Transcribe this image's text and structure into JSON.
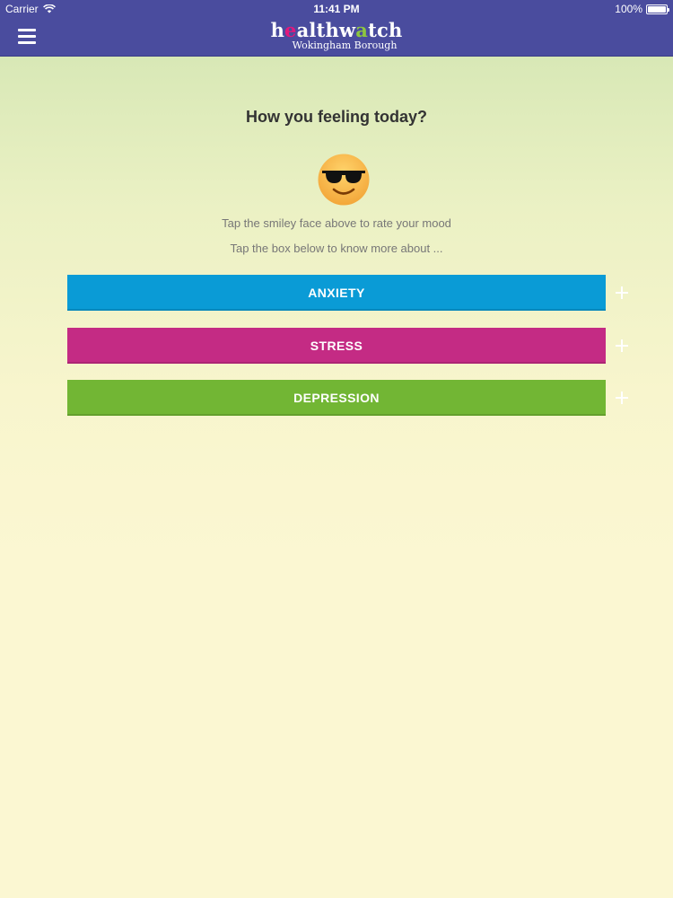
{
  "status_bar": {
    "carrier": "Carrier",
    "time": "11:41 PM",
    "battery": "100%",
    "battery_level": 1.0
  },
  "header": {
    "menu_icon": "hamburger-menu-icon",
    "logo_main_parts": [
      "h",
      "e",
      "althw",
      "a",
      "tch"
    ],
    "logo_sub": "Wokingham Borough",
    "brand_color": "#4a4c9e"
  },
  "main": {
    "title": "How you feeling today?",
    "mood_icon": "sunglasses-smiley-icon",
    "hint_rate": "Tap the smiley face above to rate your mood",
    "hint_more": "Tap the box below to know more about ...",
    "topics": [
      {
        "label": "ANXIETY",
        "color": "#0a9bd6",
        "expand_icon": "plus-icon"
      },
      {
        "label": "STRESS",
        "color": "#c42b84",
        "expand_icon": "plus-icon"
      },
      {
        "label": "DEPRESSION",
        "color": "#72b634",
        "expand_icon": "plus-icon"
      }
    ]
  }
}
